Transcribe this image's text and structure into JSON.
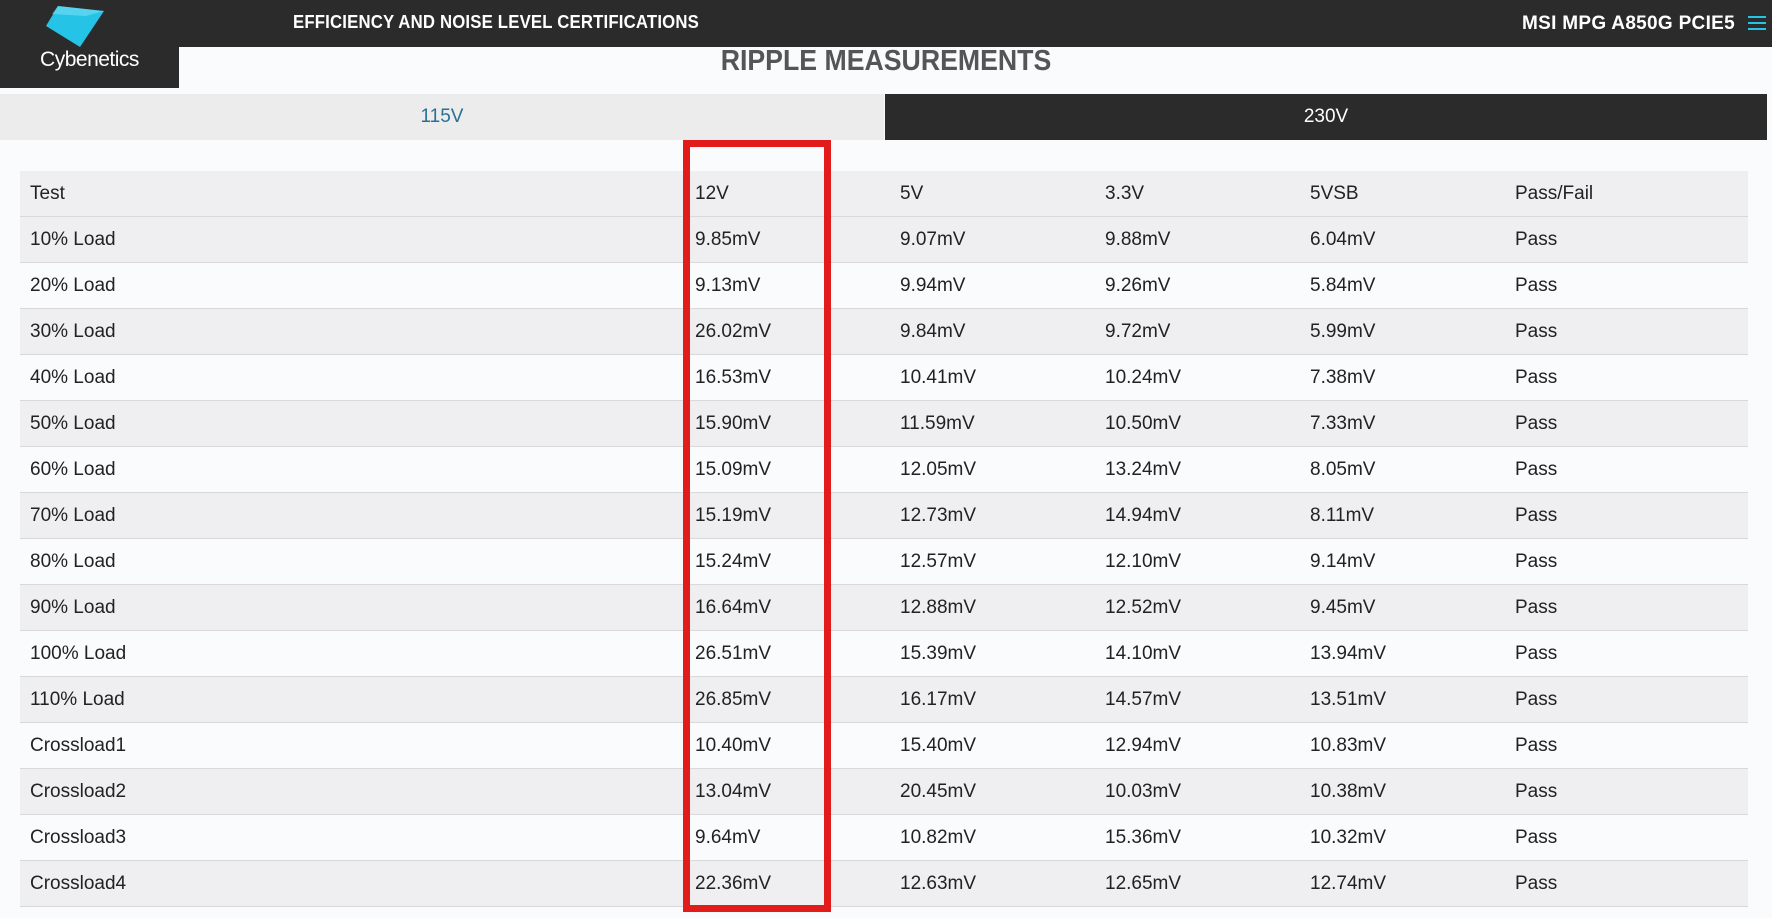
{
  "brand": {
    "logo_text": "Cybenetics",
    "logo_color": "#25c3e6"
  },
  "nav": {
    "link_label": "EFFICIENCY AND NOISE LEVEL CERTIFICATIONS"
  },
  "product": {
    "name": "MSI MPG A850G PCIE5"
  },
  "menu": {
    "icon": "hamburger-menu-icon"
  },
  "page": {
    "title": "RIPPLE MEASUREMENTS"
  },
  "tabs": [
    {
      "label": "115V"
    },
    {
      "label": "230V"
    }
  ],
  "table": {
    "headers": [
      "Test",
      "12V",
      "5V",
      "3.3V",
      "5VSB",
      "Pass/Fail"
    ],
    "rows": [
      [
        "10% Load",
        "9.85mV",
        "9.07mV",
        "9.88mV",
        "6.04mV",
        "Pass"
      ],
      [
        "20% Load",
        "9.13mV",
        "9.94mV",
        "9.26mV",
        "5.84mV",
        "Pass"
      ],
      [
        "30% Load",
        "26.02mV",
        "9.84mV",
        "9.72mV",
        "5.99mV",
        "Pass"
      ],
      [
        "40% Load",
        "16.53mV",
        "10.41mV",
        "10.24mV",
        "7.38mV",
        "Pass"
      ],
      [
        "50% Load",
        "15.90mV",
        "11.59mV",
        "10.50mV",
        "7.33mV",
        "Pass"
      ],
      [
        "60% Load",
        "15.09mV",
        "12.05mV",
        "13.24mV",
        "8.05mV",
        "Pass"
      ],
      [
        "70% Load",
        "15.19mV",
        "12.73mV",
        "14.94mV",
        "8.11mV",
        "Pass"
      ],
      [
        "80% Load",
        "15.24mV",
        "12.57mV",
        "12.10mV",
        "9.14mV",
        "Pass"
      ],
      [
        "90% Load",
        "16.64mV",
        "12.88mV",
        "12.52mV",
        "9.45mV",
        "Pass"
      ],
      [
        "100% Load",
        "26.51mV",
        "15.39mV",
        "14.10mV",
        "13.94mV",
        "Pass"
      ],
      [
        "110% Load",
        "26.85mV",
        "16.17mV",
        "14.57mV",
        "13.51mV",
        "Pass"
      ],
      [
        "Crossload1",
        "10.40mV",
        "15.40mV",
        "12.94mV",
        "10.83mV",
        "Pass"
      ],
      [
        "Crossload2",
        "13.04mV",
        "20.45mV",
        "10.03mV",
        "10.38mV",
        "Pass"
      ],
      [
        "Crossload3",
        "9.64mV",
        "10.82mV",
        "15.36mV",
        "10.32mV",
        "Pass"
      ],
      [
        "Crossload4",
        "22.36mV",
        "12.63mV",
        "12.65mV",
        "12.74mV",
        "Pass"
      ]
    ]
  },
  "highlight": {
    "color": "#e21b1b"
  }
}
